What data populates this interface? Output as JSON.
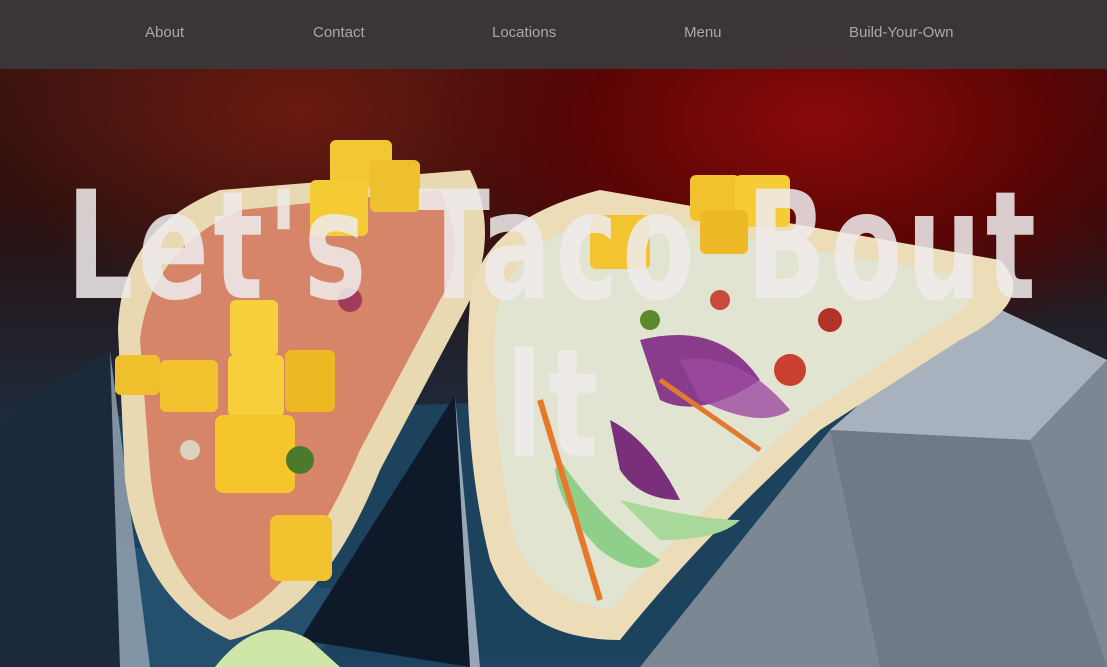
{
  "nav": {
    "items": [
      {
        "label": "About"
      },
      {
        "label": "Contact"
      },
      {
        "label": "Locations"
      },
      {
        "label": "Menu"
      },
      {
        "label": "Build-Your-Own"
      }
    ]
  },
  "hero": {
    "headline": "Let's Taco Bout It",
    "image": "tacos-photo"
  },
  "colors": {
    "navbar_bg": "#3a373a",
    "nav_text": "#a9a7a9",
    "headline_text": "#eeeaec"
  }
}
